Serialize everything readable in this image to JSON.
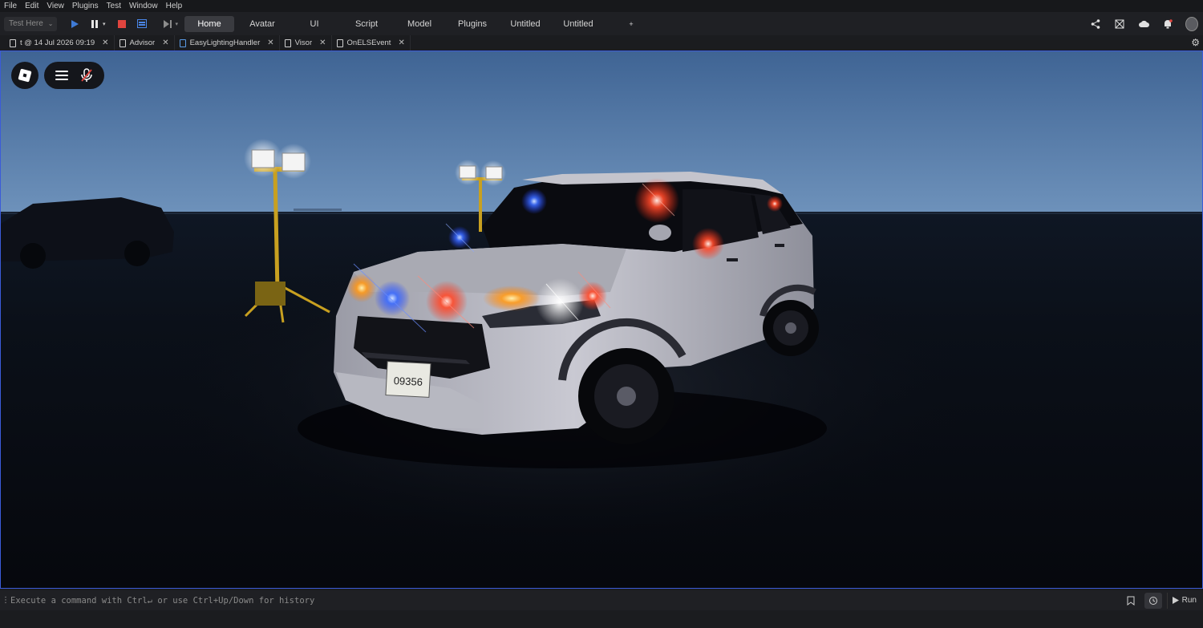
{
  "menu": [
    "File",
    "Edit",
    "View",
    "Plugins",
    "Test",
    "Window",
    "Help"
  ],
  "toolbar": {
    "test_mode": "Test Here",
    "ribbon_tabs": [
      "Home",
      "Avatar",
      "UI",
      "Script",
      "Model",
      "Plugins",
      "Untitled",
      "Untitled",
      "+"
    ],
    "active_tab": "Home"
  },
  "doc_tabs": [
    {
      "label": "t @ 14 Jul 2026 09:19",
      "icon": "place-icon"
    },
    {
      "label": "Advisor",
      "icon": "script-icon"
    },
    {
      "label": "EasyLightingHandler",
      "icon": "module-script-icon"
    },
    {
      "label": "Visor",
      "icon": "script-icon"
    },
    {
      "label": "OnELSEvent",
      "icon": "script-icon"
    }
  ],
  "scene": {
    "license_plate": "09356",
    "accent_border": "#3b5bd9",
    "sky_top": "#4a6f9c",
    "sky_horizon": "#6b8fb8",
    "ground": "#0a0d14"
  },
  "command_bar": {
    "placeholder": "Execute a command with Ctrl↵ or use Ctrl+Up/Down for history",
    "run_label": "Run"
  }
}
